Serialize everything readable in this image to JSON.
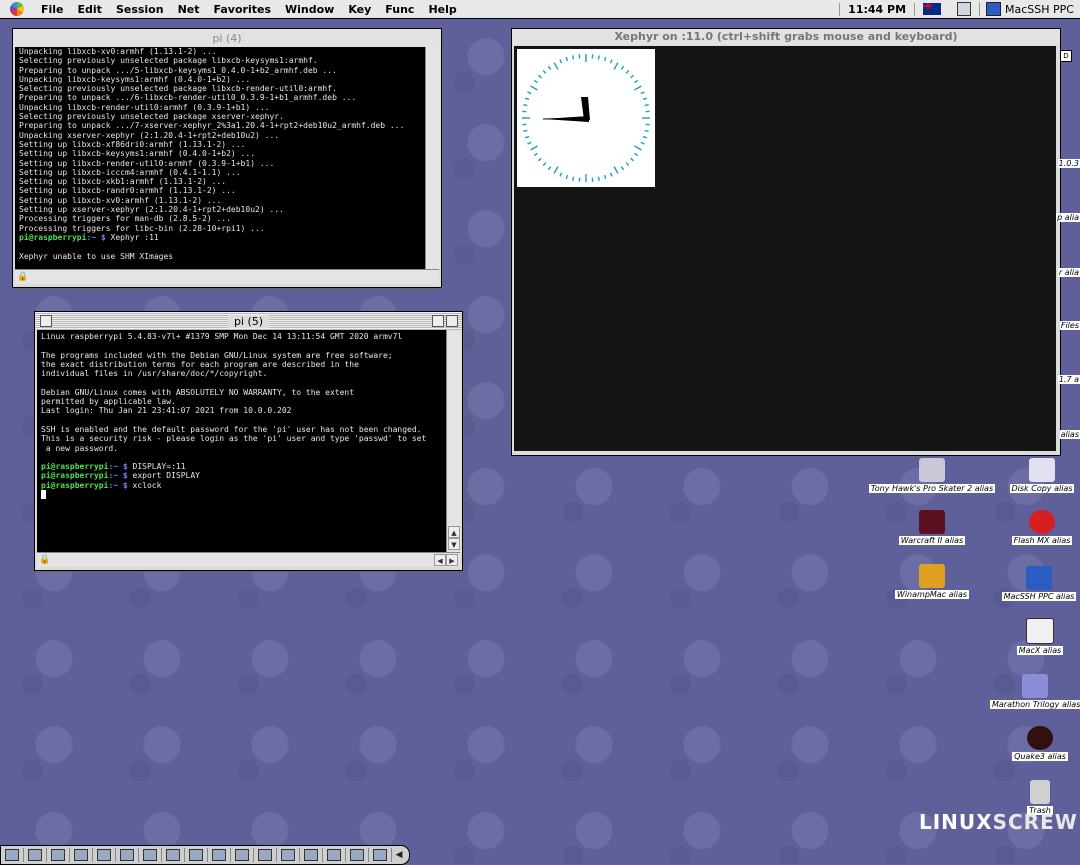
{
  "menubar": {
    "items": [
      "File",
      "Edit",
      "Session",
      "Net",
      "Favorites",
      "Window",
      "Key",
      "Func",
      "Help"
    ],
    "time": "11:44 PM",
    "app_name": "MacSSH PPC"
  },
  "term1": {
    "title": "pi (4)",
    "lines": [
      "Unpacking libxcb-xv0:armhf (1.13.1-2) ...",
      "Selecting previously unselected package libxcb-keysyms1:armhf.",
      "Preparing to unpack .../5-libxcb-keysyms1_0.4.0-1+b2_armhf.deb ...",
      "Unpacking libxcb-keysyms1:armhf (0.4.0-1+b2) ...",
      "Selecting previously unselected package libxcb-render-util0:armhf.",
      "Preparing to unpack .../6-libxcb-render-util0_0.3.9-1+b1_armhf.deb ...",
      "Unpacking libxcb-render-util0:armhf (0.3.9-1+b1) ...",
      "Selecting previously unselected package xserver-xephyr.",
      "Preparing to unpack .../7-xserver-xephyr_2%3a1.20.4-1+rpt2+deb10u2_armhf.deb ...",
      "Unpacking xserver-xephyr (2:1.20.4-1+rpt2+deb10u2) ...",
      "Setting up libxcb-xf86dri0:armhf (1.13.1-2) ...",
      "Setting up libxcb-keysyms1:armhf (0.4.0-1+b2) ...",
      "Setting up libxcb-render-util0:armhf (0.3.9-1+b1) ...",
      "Setting up libxcb-icccm4:armhf (0.4.1-1.1) ...",
      "Setting up libxcb-xkb1:armhf (1.13.1-2) ...",
      "Setting up libxcb-randr0:armhf (1.13.1-2) ...",
      "Setting up libxcb-xv0:armhf (1.13.1-2) ...",
      "Setting up xserver-xephyr (2:1.20.4-1+rpt2+deb10u2) ...",
      "Processing triggers for man-db (2.8.5-2) ...",
      "Processing triggers for libc-bin (2.28-10+rpi1) ..."
    ],
    "prompt_user": "pi@raspberrypi",
    "prompt_path": ":~ $",
    "command": "Xephyr :11",
    "message": "Xephyr unable to use SHM XImages"
  },
  "term2": {
    "title": "pi (5)",
    "lines": [
      "Linux raspberrypi 5.4.83-v7l+ #1379 SMP Mon Dec 14 13:11:54 GMT 2020 armv7l",
      "",
      "The programs included with the Debian GNU/Linux system are free software;",
      "the exact distribution terms for each program are described in the",
      "individual files in /usr/share/doc/*/copyright.",
      "",
      "Debian GNU/Linux comes with ABSOLUTELY NO WARRANTY, to the extent",
      "permitted by applicable law.",
      "Last login: Thu Jan 21 23:41:07 2021 from 10.0.0.202",
      "",
      "SSH is enabled and the default password for the 'pi' user has not been changed.",
      "This is a security risk - please login as the 'pi' user and type 'passwd' to set",
      " a new password.",
      ""
    ],
    "prompt_user": "pi@raspberrypi",
    "prompt_path": ":~ $",
    "cmd1": "DISPLAY=:11",
    "cmd2": "export DISPLAY",
    "cmd3": "xclock"
  },
  "xephyr": {
    "title": "Xephyr on :11.0 (ctrl+shift grabs mouse and keyboard)"
  },
  "desktop_icons": [
    {
      "label": "Tony Hawk's Pro Skater 2 alias",
      "icon": "skater-icon",
      "color": "#c8c8d8"
    },
    {
      "label": "Disk Copy alias",
      "icon": "disk-copy-icon",
      "color": "#e0e0f0"
    },
    {
      "label": "Warcraft II alias",
      "icon": "warcraft-icon",
      "color": "#5a1020"
    },
    {
      "label": "Flash MX alias",
      "icon": "flash-icon",
      "color": "#d42020"
    },
    {
      "label": "WinampMac alias",
      "icon": "winamp-icon",
      "color": "#e0a020"
    },
    {
      "label": "MacSSH PPC alias",
      "icon": "macssh-icon",
      "color": "#2a5cc4"
    },
    {
      "label": "MacX alias",
      "icon": "macx-icon",
      "color": "#f0f0f0"
    },
    {
      "label": "Marathon Trilogy alias",
      "icon": "folder-icon",
      "color": "#8c8cd8"
    },
    {
      "label": "Quake3 alias",
      "icon": "quake-icon",
      "color": "#301010"
    },
    {
      "label": "Trash",
      "icon": "trash-icon",
      "color": "#d0d0d0"
    }
  ],
  "edge_labels": [
    "1.0.3",
    "p alia",
    "r alia",
    "Files",
    "1.7 a",
    "alias"
  ],
  "watermark": {
    "part1": "LINUX",
    "part2": "SCREW"
  }
}
